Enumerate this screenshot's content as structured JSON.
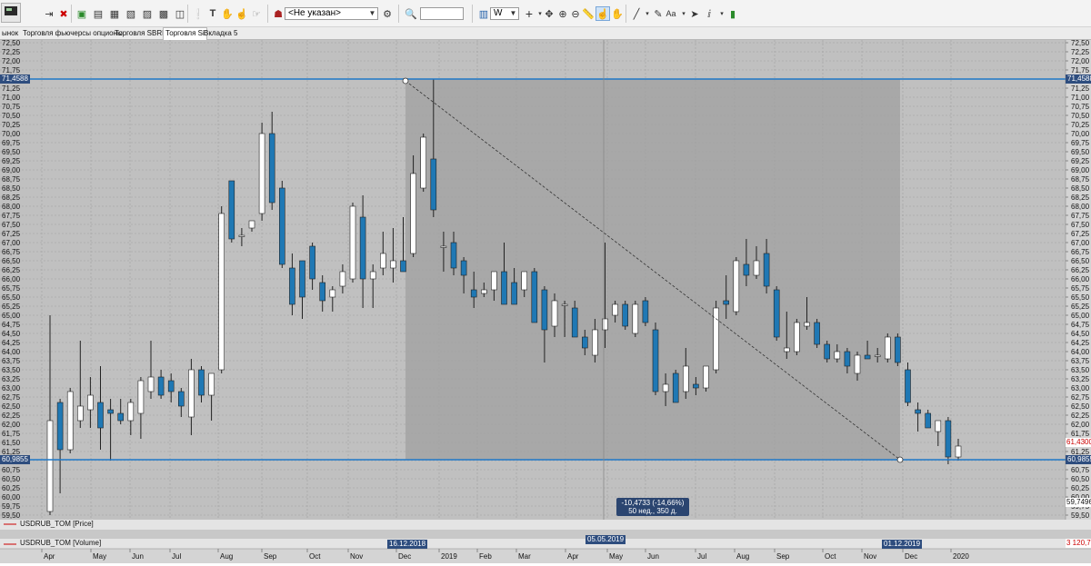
{
  "toolbar": {
    "broker_placeholder": "<Не указан>",
    "search_value": "",
    "timeframe": "W"
  },
  "tabs": [
    {
      "label": "ынок"
    },
    {
      "label": "Торговля фьючерсы опционы"
    },
    {
      "label": "Торговля SBRF"
    },
    {
      "label": "Торговля Si"
    },
    {
      "label": "Вкладка 5"
    }
  ],
  "price_axis": {
    "ticks": [
      "72,50",
      "72,25",
      "72,00",
      "71,75",
      "71,50",
      "71,25",
      "71,00",
      "70,75",
      "70,50",
      "70,25",
      "70,00",
      "69,75",
      "69,50",
      "69,25",
      "69,00",
      "68,75",
      "68,50",
      "68,25",
      "68,00",
      "67,75",
      "67,50",
      "67,25",
      "67,00",
      "66,75",
      "66,50",
      "66,25",
      "66,00",
      "65,75",
      "65,50",
      "65,25",
      "65,00",
      "64,75",
      "64,50",
      "64,25",
      "64,00",
      "63,75",
      "63,50",
      "63,25",
      "63,00",
      "62,75",
      "62,50",
      "62,25",
      "62,00",
      "61,75",
      "61,50",
      "61,25",
      "61,00",
      "60,75",
      "60,50",
      "60,25",
      "60,00",
      "59,75",
      "59,50"
    ],
    "hline_top_label": "71,4588",
    "hline_bottom_label": "60,9855",
    "last_price_label": "61,4300",
    "min_label": "59,7496"
  },
  "time_axis": {
    "months": [
      "Apr",
      "May",
      "Jun",
      "Jul",
      "Aug",
      "Sep",
      "Oct",
      "Nov",
      "Dec",
      "2019",
      "Feb",
      "Mar",
      "Apr",
      "May",
      "Jun",
      "Jul",
      "Aug",
      "Sep",
      "Oct",
      "Nov",
      "Dec",
      "2020"
    ],
    "flag_start": "16.12.2018",
    "flag_mid": "05.05.2019",
    "flag_end": "01.12.2019"
  },
  "legends": {
    "price": "USDRUB_TOM [Price]",
    "volume": "USDRUB_TOM [Volume]",
    "volume_value": "3 120,7"
  },
  "measure": {
    "line1": "-10,4733 (-14,66%)",
    "line2": "50 нед., 350 д."
  },
  "colors": {
    "up": "#ffffff",
    "down": "#1f78b4",
    "hline": "#1f78c8",
    "background": "#c0c0c0",
    "selection": "#a8a8a8"
  },
  "chart_data": {
    "type": "candlestick",
    "symbol": "USDRUB_TOM",
    "timeframe": "W",
    "ylim": [
      59.5,
      72.5
    ],
    "candles": [
      {
        "o": 59.6,
        "h": 65.0,
        "l": 59.5,
        "c": 62.1
      },
      {
        "o": 62.6,
        "h": 62.7,
        "l": 60.1,
        "c": 61.3
      },
      {
        "o": 61.3,
        "h": 63.0,
        "l": 61.2,
        "c": 62.9
      },
      {
        "o": 62.1,
        "h": 64.3,
        "l": 61.9,
        "c": 62.5
      },
      {
        "o": 62.4,
        "h": 63.3,
        "l": 61.9,
        "c": 62.8
      },
      {
        "o": 62.6,
        "h": 63.6,
        "l": 61.3,
        "c": 61.9
      },
      {
        "o": 62.4,
        "h": 62.7,
        "l": 61.0,
        "c": 62.3
      },
      {
        "o": 62.3,
        "h": 62.7,
        "l": 62.0,
        "c": 62.1
      },
      {
        "o": 62.1,
        "h": 62.7,
        "l": 61.7,
        "c": 62.6
      },
      {
        "o": 62.3,
        "h": 63.3,
        "l": 61.6,
        "c": 63.2
      },
      {
        "o": 62.9,
        "h": 64.3,
        "l": 62.7,
        "c": 63.3
      },
      {
        "o": 63.3,
        "h": 63.5,
        "l": 62.7,
        "c": 62.8
      },
      {
        "o": 63.2,
        "h": 63.4,
        "l": 62.6,
        "c": 62.9
      },
      {
        "o": 62.9,
        "h": 63.0,
        "l": 62.2,
        "c": 62.5
      },
      {
        "o": 62.2,
        "h": 63.8,
        "l": 61.7,
        "c": 63.5
      },
      {
        "o": 63.5,
        "h": 63.6,
        "l": 62.6,
        "c": 62.8
      },
      {
        "o": 62.8,
        "h": 63.4,
        "l": 62.1,
        "c": 63.4
      },
      {
        "o": 63.5,
        "h": 68.0,
        "l": 63.4,
        "c": 67.8
      },
      {
        "o": 68.7,
        "h": 68.7,
        "l": 67.0,
        "c": 67.1
      },
      {
        "o": 67.2,
        "h": 67.4,
        "l": 66.9,
        "c": 67.2
      },
      {
        "o": 67.4,
        "h": 67.6,
        "l": 67.3,
        "c": 67.6
      },
      {
        "o": 67.8,
        "h": 70.3,
        "l": 67.6,
        "c": 70.0
      },
      {
        "o": 70.0,
        "h": 70.6,
        "l": 67.9,
        "c": 68.1
      },
      {
        "o": 68.5,
        "h": 68.7,
        "l": 66.3,
        "c": 66.4
      },
      {
        "o": 66.3,
        "h": 66.7,
        "l": 65.0,
        "c": 65.3
      },
      {
        "o": 66.5,
        "h": 66.5,
        "l": 64.9,
        "c": 65.5
      },
      {
        "o": 66.9,
        "h": 67.0,
        "l": 65.7,
        "c": 66.0
      },
      {
        "o": 65.9,
        "h": 66.1,
        "l": 65.1,
        "c": 65.4
      },
      {
        "o": 65.5,
        "h": 65.8,
        "l": 65.1,
        "c": 65.7
      },
      {
        "o": 65.8,
        "h": 66.4,
        "l": 65.6,
        "c": 66.2
      },
      {
        "o": 66.0,
        "h": 68.1,
        "l": 65.9,
        "c": 68.0
      },
      {
        "o": 67.7,
        "h": 68.3,
        "l": 65.2,
        "c": 66.0
      },
      {
        "o": 66.0,
        "h": 66.4,
        "l": 65.2,
        "c": 66.2
      },
      {
        "o": 66.3,
        "h": 67.3,
        "l": 66.1,
        "c": 66.7
      },
      {
        "o": 66.3,
        "h": 67.4,
        "l": 65.9,
        "c": 66.5
      },
      {
        "o": 66.5,
        "h": 67.7,
        "l": 66.3,
        "c": 66.2
      },
      {
        "o": 66.7,
        "h": 69.4,
        "l": 66.6,
        "c": 68.9
      },
      {
        "o": 68.5,
        "h": 70.0,
        "l": 68.4,
        "c": 69.9
      },
      {
        "o": 69.3,
        "h": 71.5,
        "l": 67.7,
        "c": 67.9
      },
      {
        "o": 66.9,
        "h": 67.3,
        "l": 66.2,
        "c": 66.9
      },
      {
        "o": 67.0,
        "h": 67.3,
        "l": 66.1,
        "c": 66.3
      },
      {
        "o": 66.5,
        "h": 66.6,
        "l": 65.6,
        "c": 66.1
      },
      {
        "o": 65.7,
        "h": 66.2,
        "l": 65.2,
        "c": 65.5
      },
      {
        "o": 65.6,
        "h": 65.9,
        "l": 65.5,
        "c": 65.7
      },
      {
        "o": 65.7,
        "h": 66.0,
        "l": 65.4,
        "c": 66.2
      },
      {
        "o": 66.2,
        "h": 67.0,
        "l": 65.3,
        "c": 65.3
      },
      {
        "o": 65.9,
        "h": 66.3,
        "l": 65.7,
        "c": 65.3
      },
      {
        "o": 65.7,
        "h": 66.2,
        "l": 65.5,
        "c": 66.2
      },
      {
        "o": 66.2,
        "h": 66.3,
        "l": 64.8,
        "c": 64.8
      },
      {
        "o": 65.7,
        "h": 65.8,
        "l": 63.7,
        "c": 64.6
      },
      {
        "o": 64.7,
        "h": 65.6,
        "l": 64.4,
        "c": 65.4
      },
      {
        "o": 65.3,
        "h": 65.4,
        "l": 64.4,
        "c": 65.3
      },
      {
        "o": 65.2,
        "h": 65.4,
        "l": 64.4,
        "c": 64.4
      },
      {
        "o": 64.4,
        "h": 64.6,
        "l": 63.9,
        "c": 64.1
      },
      {
        "o": 63.9,
        "h": 64.9,
        "l": 63.7,
        "c": 64.6
      },
      {
        "o": 64.6,
        "h": 67.0,
        "l": 64.1,
        "c": 64.9
      },
      {
        "o": 65.0,
        "h": 65.4,
        "l": 64.8,
        "c": 65.3
      },
      {
        "o": 65.3,
        "h": 65.4,
        "l": 64.6,
        "c": 64.7
      },
      {
        "o": 64.5,
        "h": 65.4,
        "l": 64.4,
        "c": 65.3
      },
      {
        "o": 65.4,
        "h": 65.5,
        "l": 64.7,
        "c": 64.8
      },
      {
        "o": 64.6,
        "h": 64.8,
        "l": 62.8,
        "c": 62.9
      },
      {
        "o": 62.9,
        "h": 63.4,
        "l": 62.5,
        "c": 63.1
      },
      {
        "o": 63.4,
        "h": 63.5,
        "l": 62.6,
        "c": 62.6
      },
      {
        "o": 62.9,
        "h": 64.1,
        "l": 62.7,
        "c": 63.6
      },
      {
        "o": 63.1,
        "h": 63.3,
        "l": 62.8,
        "c": 63.0
      },
      {
        "o": 63.0,
        "h": 63.6,
        "l": 62.9,
        "c": 63.6
      },
      {
        "o": 63.5,
        "h": 65.4,
        "l": 63.4,
        "c": 65.2
      },
      {
        "o": 65.4,
        "h": 66.1,
        "l": 64.9,
        "c": 65.3
      },
      {
        "o": 65.1,
        "h": 66.6,
        "l": 65.0,
        "c": 66.5
      },
      {
        "o": 66.4,
        "h": 67.1,
        "l": 65.8,
        "c": 66.1
      },
      {
        "o": 66.1,
        "h": 66.9,
        "l": 66.0,
        "c": 66.5
      },
      {
        "o": 66.7,
        "h": 67.1,
        "l": 65.6,
        "c": 65.8
      },
      {
        "o": 65.7,
        "h": 65.8,
        "l": 64.3,
        "c": 64.4
      },
      {
        "o": 64.0,
        "h": 65.1,
        "l": 63.8,
        "c": 64.1
      },
      {
        "o": 64.0,
        "h": 64.9,
        "l": 63.9,
        "c": 64.8
      },
      {
        "o": 64.7,
        "h": 65.5,
        "l": 64.6,
        "c": 64.8
      },
      {
        "o": 64.8,
        "h": 64.9,
        "l": 64.1,
        "c": 64.2
      },
      {
        "o": 64.2,
        "h": 64.3,
        "l": 63.7,
        "c": 63.8
      },
      {
        "o": 63.8,
        "h": 64.2,
        "l": 63.7,
        "c": 64.0
      },
      {
        "o": 64.0,
        "h": 64.1,
        "l": 63.4,
        "c": 63.6
      },
      {
        "o": 63.4,
        "h": 64.0,
        "l": 63.2,
        "c": 63.9
      },
      {
        "o": 63.9,
        "h": 64.3,
        "l": 63.8,
        "c": 63.8
      },
      {
        "o": 63.9,
        "h": 64.1,
        "l": 63.7,
        "c": 63.9
      },
      {
        "o": 63.8,
        "h": 64.5,
        "l": 63.7,
        "c": 64.4
      },
      {
        "o": 64.4,
        "h": 64.5,
        "l": 63.6,
        "c": 63.7
      },
      {
        "o": 63.5,
        "h": 63.7,
        "l": 62.5,
        "c": 62.6
      },
      {
        "o": 62.4,
        "h": 62.6,
        "l": 61.8,
        "c": 62.3
      },
      {
        "o": 62.3,
        "h": 62.4,
        "l": 61.9,
        "c": 61.9
      },
      {
        "o": 61.8,
        "h": 62.1,
        "l": 61.4,
        "c": 62.1
      },
      {
        "o": 62.1,
        "h": 62.2,
        "l": 60.9,
        "c": 61.1
      },
      {
        "o": 61.1,
        "h": 61.6,
        "l": 61.0,
        "c": 61.4
      }
    ],
    "hlines": [
      71.4588,
      60.9855
    ],
    "last_price": 61.43,
    "min_marker": 59.7496,
    "measurement": {
      "change": -10.4733,
      "percent": -14.66,
      "weeks": 50,
      "days": 350
    }
  }
}
